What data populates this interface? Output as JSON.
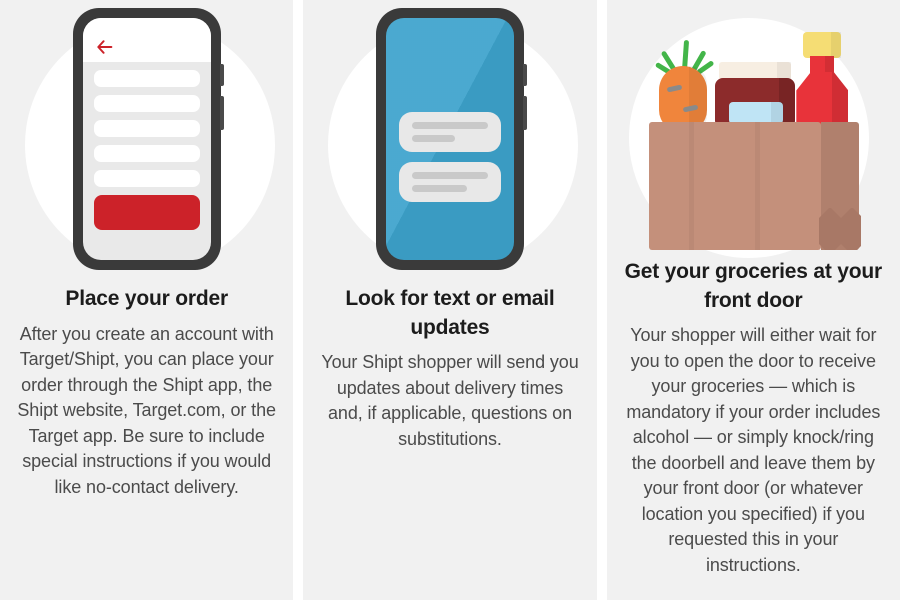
{
  "theme": {
    "page_background": "#ffffff",
    "panel_background": "#f1f1f1",
    "circle_background": "#ffffff",
    "heading_color": "#1c1c1c",
    "body_color": "#4b4b4b",
    "phone_frame": "#3a3a3a",
    "accent_red": "#cc2229",
    "accent_blue": "#3da3cc",
    "bag_brown": "#c4907b",
    "carrot_orange": "#f0853c",
    "leaf_green": "#43b549",
    "bottle_red": "#e8333a",
    "bottle_cap_yellow": "#f5dd74",
    "jar_red": "#8c2b2b",
    "jar_lid_cream": "#f7eee2",
    "jar_label_blue": "#bfe4f5"
  },
  "steps": [
    {
      "id": "step-place-order",
      "heading": "Place your order",
      "body": "After you create an account with Target/Shipt, you can place your order through the Shipt app, the Shipt website, Target.com, or the Target app. Be sure to include special instructions if you would like no-contact delivery.",
      "illustration": "phone-order-list",
      "icons": {
        "back_arrow": "back-arrow-icon"
      },
      "list_row_count": 5,
      "cta_present": true
    },
    {
      "id": "step-look-for-updates",
      "heading": "Look for text or email updates",
      "body": "Your Shipt shopper will send you updates about delivery times and, if applicable, questions on substitutions.",
      "illustration": "phone-message-bubbles",
      "bubbles": [
        {
          "lines": [
            "long",
            "short"
          ]
        },
        {
          "lines": [
            "long",
            "medium"
          ]
        }
      ]
    },
    {
      "id": "step-get-groceries",
      "heading": "Get your groceries at your front door",
      "body": "Your shopper will either wait for you to open the door to receive your groceries — which is mandatory if your order includes alcohol — or simply knock/ring the doorbell and leave them by your front door (or whatever location you specified) if you requested this in your instructions.",
      "illustration": "grocery-bag",
      "items": [
        "carrot",
        "jar",
        "bottle",
        "paper-bag"
      ]
    }
  ]
}
